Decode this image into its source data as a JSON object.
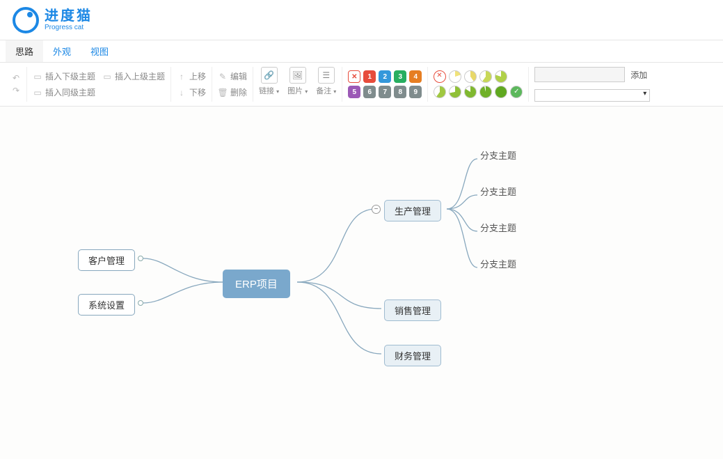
{
  "app": {
    "name_cn": "进度猫",
    "name_en": "Progress cat"
  },
  "tabs": [
    "思路",
    "外观",
    "视图"
  ],
  "toolbar": {
    "insert_child": "插入下级主题",
    "insert_parent": "插入上级主题",
    "insert_sibling": "插入同级主题",
    "move_up": "上移",
    "move_down": "下移",
    "edit": "编辑",
    "delete": "删除",
    "link": "链接",
    "image": "图片",
    "note": "备注",
    "add": "添加",
    "priority_numbers": [
      "1",
      "2",
      "3",
      "4",
      "5",
      "6",
      "7",
      "8",
      "9"
    ],
    "priority_colors": [
      "#e74c3c",
      "#3498db",
      "#27ae60",
      "#e67e22",
      "#9b59b6",
      "#7f8c8d",
      "#7f8c8d",
      "#7f8c8d",
      "#7f8c8d"
    ],
    "progress_colors_top": [
      "#f0e27a",
      "#e8d86a",
      "#c8d858",
      "#b0d048"
    ],
    "progress_colors_bot": [
      "#a0c840",
      "#90c038",
      "#80b830",
      "#70b028",
      "#60a820"
    ]
  },
  "mindmap": {
    "root": "ERP项目",
    "left": [
      "客户管理",
      "系统设置"
    ],
    "right": [
      {
        "label": "生产管理",
        "children": [
          "分支主题",
          "分支主题",
          "分支主题",
          "分支主题"
        ]
      },
      {
        "label": "销售管理",
        "children": []
      },
      {
        "label": "财务管理",
        "children": []
      }
    ]
  }
}
